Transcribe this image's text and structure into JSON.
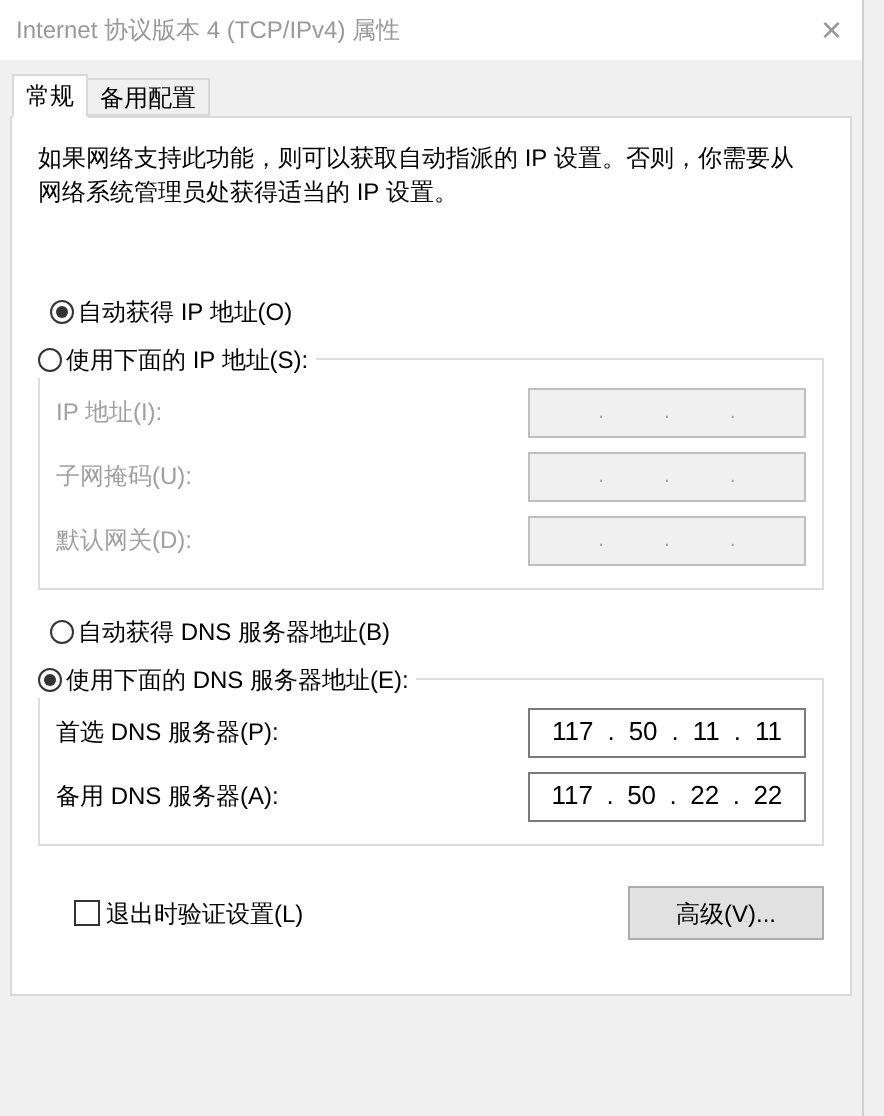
{
  "window": {
    "title": "Internet 协议版本 4 (TCP/IPv4) 属性",
    "close": "×"
  },
  "tabs": [
    {
      "label": "常规",
      "selected": true
    },
    {
      "label": "备用配置",
      "selected": false
    }
  ],
  "description": "如果网络支持此功能，则可以获取自动指派的 IP 设置。否则，你需要从网络系统管理员处获得适当的 IP 设置。",
  "ip_section": {
    "options": [
      {
        "label": "自动获得 IP 地址(O)",
        "selected": true
      },
      {
        "label": "使用下面的 IP 地址(S):",
        "selected": false
      }
    ],
    "disabled": true,
    "fields": [
      {
        "label": "IP 地址(I):",
        "parts": [
          ".",
          ".",
          "."
        ]
      },
      {
        "label": "子网掩码(U):",
        "parts": [
          ".",
          ".",
          "."
        ]
      },
      {
        "label": "默认网关(D):",
        "parts": [
          ".",
          ".",
          "."
        ]
      }
    ]
  },
  "dns_section": {
    "options": [
      {
        "label": "自动获得 DNS 服务器地址(B)",
        "selected": false
      },
      {
        "label": "使用下面的 DNS 服务器地址(E):",
        "selected": true
      }
    ],
    "disabled": false,
    "fields": [
      {
        "label": "首选 DNS 服务器(P):",
        "parts": [
          "117",
          ".",
          "50",
          ".",
          "11",
          ".",
          "11"
        ]
      },
      {
        "label": "备用 DNS 服务器(A):",
        "parts": [
          "117",
          ".",
          "50",
          ".",
          "22",
          ".",
          "22"
        ]
      }
    ]
  },
  "validate_on_exit": {
    "label": "退出时验证设置(L)",
    "checked": false
  },
  "advanced_button": "高级(V)..."
}
